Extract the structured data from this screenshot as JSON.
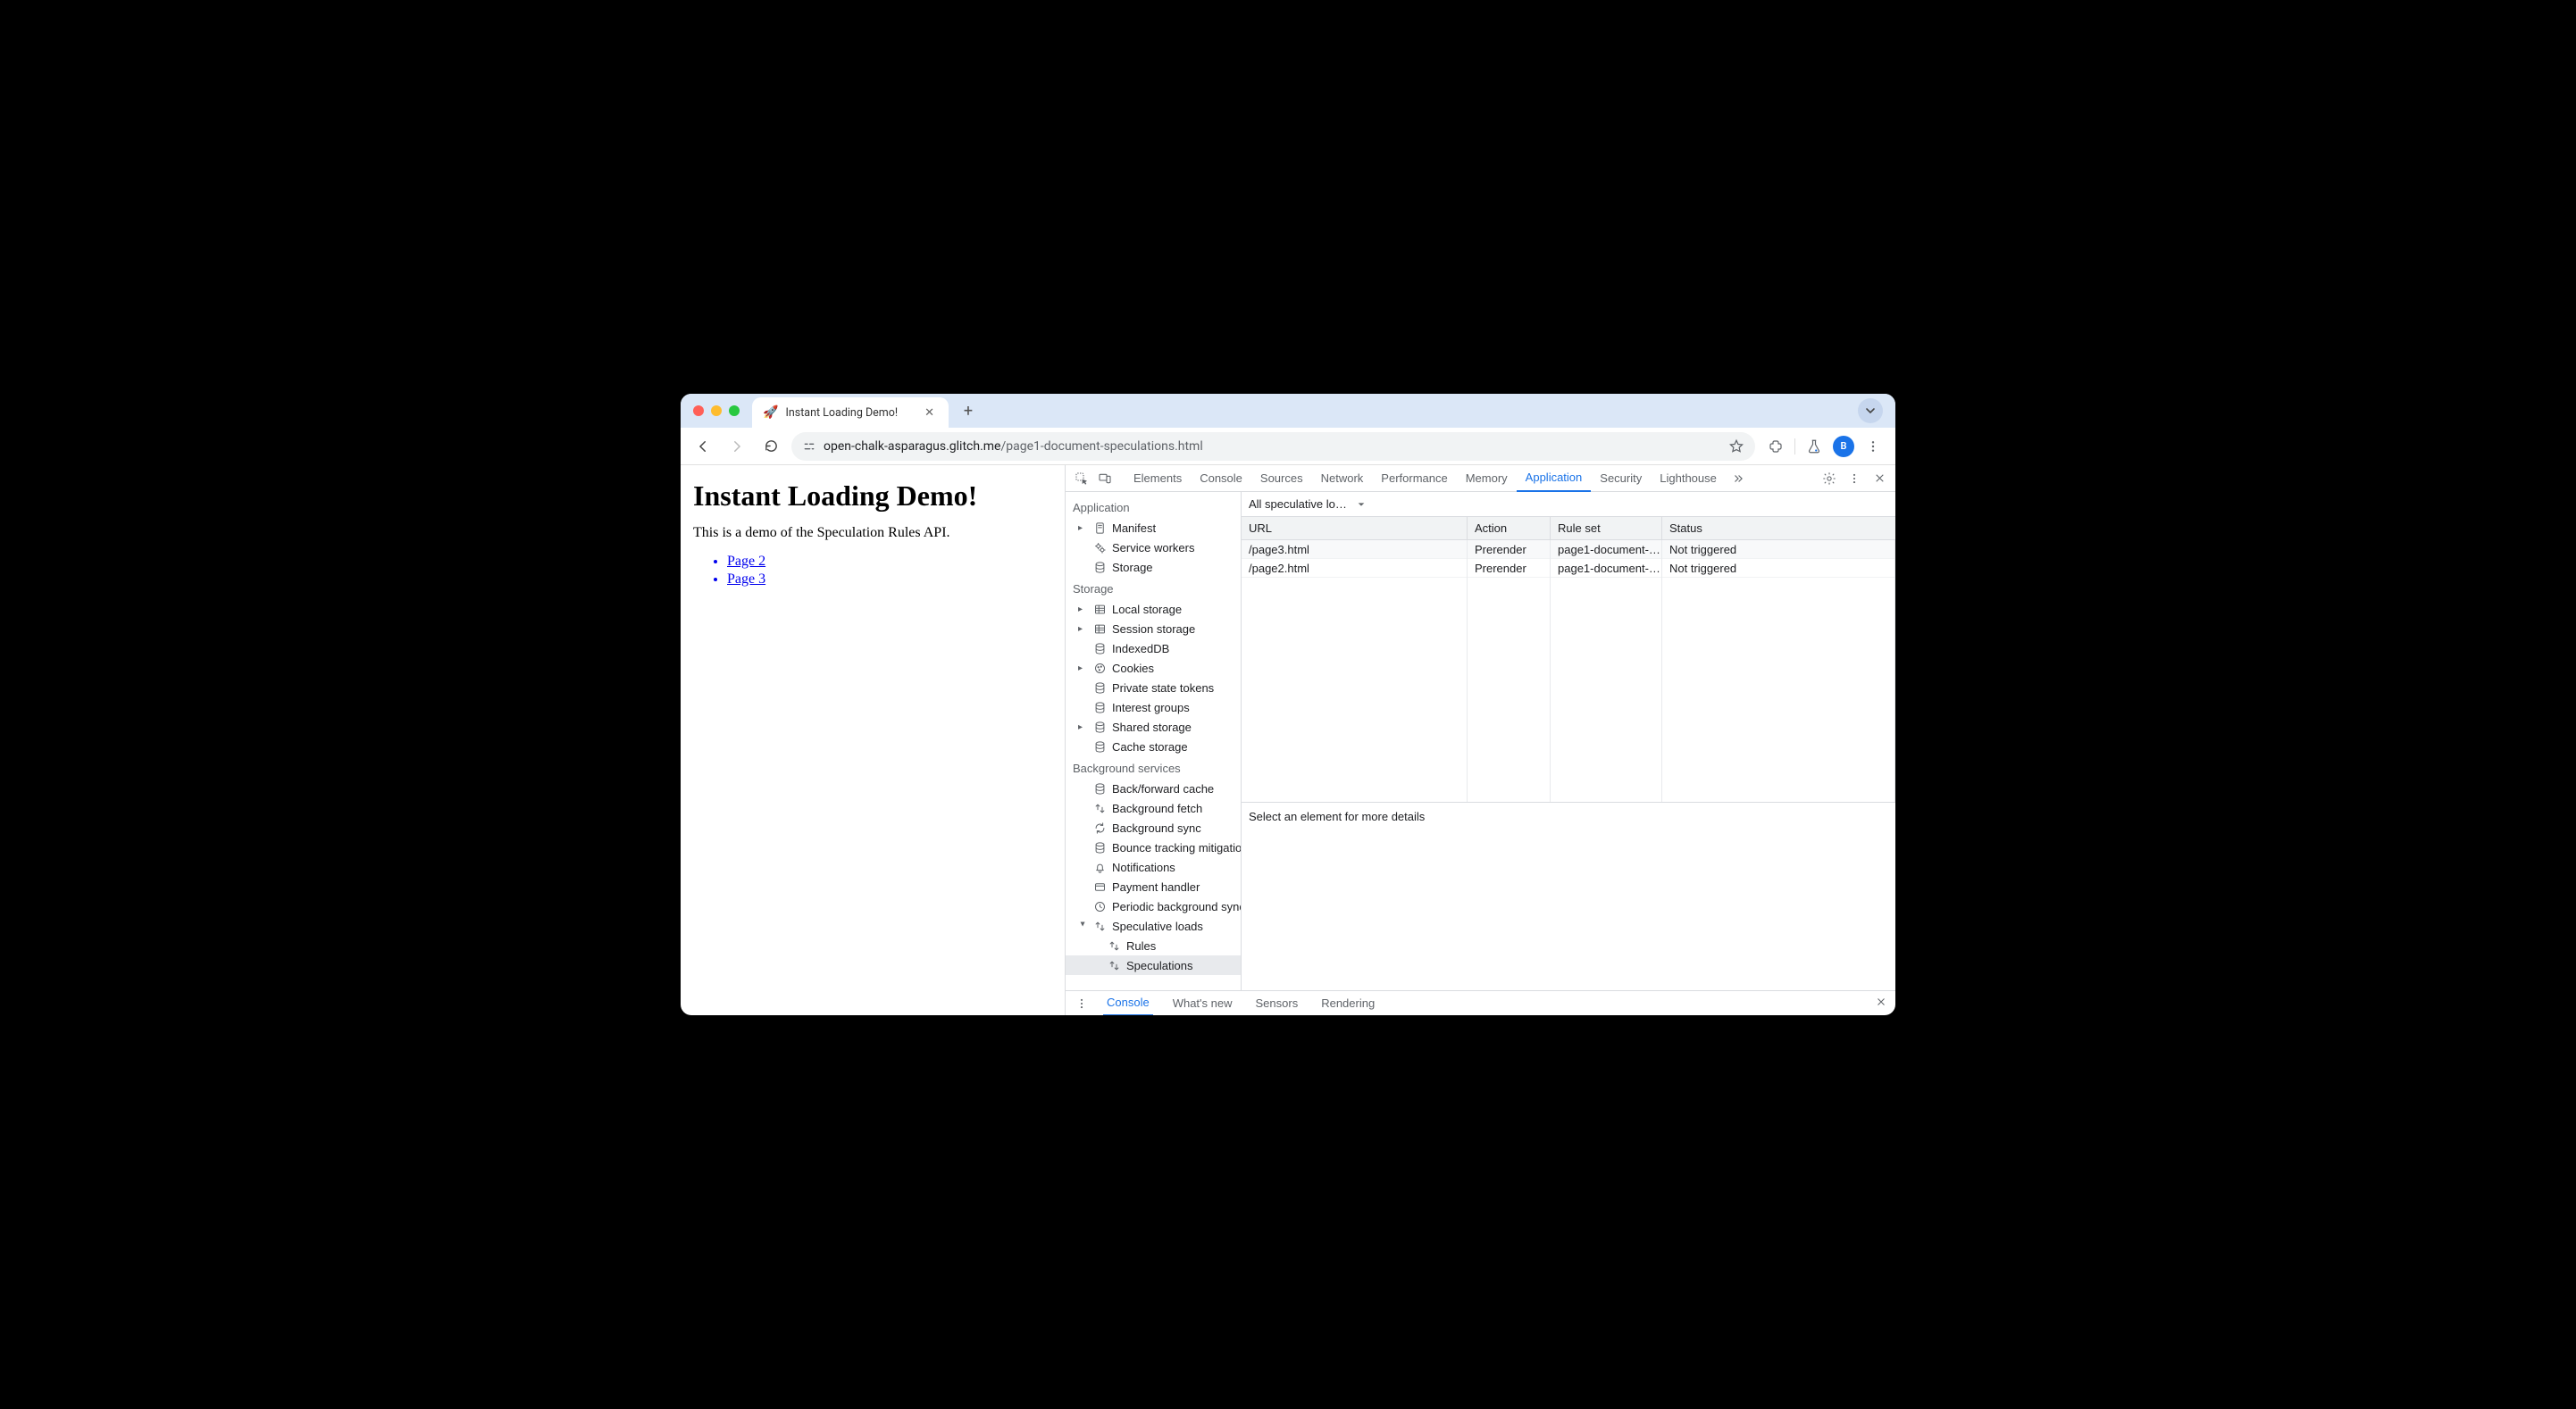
{
  "tab": {
    "favicon": "🚀",
    "title": "Instant Loading Demo!"
  },
  "url": {
    "host": "open-chalk-asparagus.glitch.me",
    "path": "/page1-document-speculations.html"
  },
  "avatar": "B",
  "page": {
    "heading": "Instant Loading Demo!",
    "intro": "This is a demo of the Speculation Rules API.",
    "links": [
      "Page 2",
      "Page 3"
    ]
  },
  "devtools": {
    "tabs": [
      "Elements",
      "Console",
      "Sources",
      "Network",
      "Performance",
      "Memory",
      "Application",
      "Security",
      "Lighthouse"
    ],
    "active_tab": "Application",
    "sidebar": {
      "sections": [
        {
          "title": "Application",
          "items": [
            {
              "label": "Manifest",
              "icon": "file",
              "caret": true
            },
            {
              "label": "Service workers",
              "icon": "gears"
            },
            {
              "label": "Storage",
              "icon": "db"
            }
          ]
        },
        {
          "title": "Storage",
          "items": [
            {
              "label": "Local storage",
              "icon": "table",
              "caret": true
            },
            {
              "label": "Session storage",
              "icon": "table",
              "caret": true
            },
            {
              "label": "IndexedDB",
              "icon": "db"
            },
            {
              "label": "Cookies",
              "icon": "cookie",
              "caret": true
            },
            {
              "label": "Private state tokens",
              "icon": "db"
            },
            {
              "label": "Interest groups",
              "icon": "db"
            },
            {
              "label": "Shared storage",
              "icon": "db",
              "caret": true
            },
            {
              "label": "Cache storage",
              "icon": "db"
            }
          ]
        },
        {
          "title": "Background services",
          "items": [
            {
              "label": "Back/forward cache",
              "icon": "db"
            },
            {
              "label": "Background fetch",
              "icon": "updown"
            },
            {
              "label": "Background sync",
              "icon": "sync"
            },
            {
              "label": "Bounce tracking mitigation",
              "icon": "db"
            },
            {
              "label": "Notifications",
              "icon": "bell"
            },
            {
              "label": "Payment handler",
              "icon": "card"
            },
            {
              "label": "Periodic background sync",
              "icon": "clock"
            },
            {
              "label": "Speculative loads",
              "icon": "updown",
              "caret": true,
              "open": true,
              "children": [
                {
                  "label": "Rules",
                  "icon": "updown"
                },
                {
                  "label": "Speculations",
                  "icon": "updown",
                  "active": true
                }
              ]
            }
          ]
        }
      ]
    },
    "filter_label": "All speculative loa…",
    "columns": [
      "URL",
      "Action",
      "Rule set",
      "Status"
    ],
    "rows": [
      {
        "url": "/page3.html",
        "action": "Prerender",
        "ruleset": "page1-document-…",
        "status": "Not triggered"
      },
      {
        "url": "/page2.html",
        "action": "Prerender",
        "ruleset": "page1-document-…",
        "status": "Not triggered"
      }
    ],
    "detail_placeholder": "Select an element for more details",
    "drawer_tabs": [
      "Console",
      "What's new",
      "Sensors",
      "Rendering"
    ],
    "drawer_active": "Console"
  }
}
